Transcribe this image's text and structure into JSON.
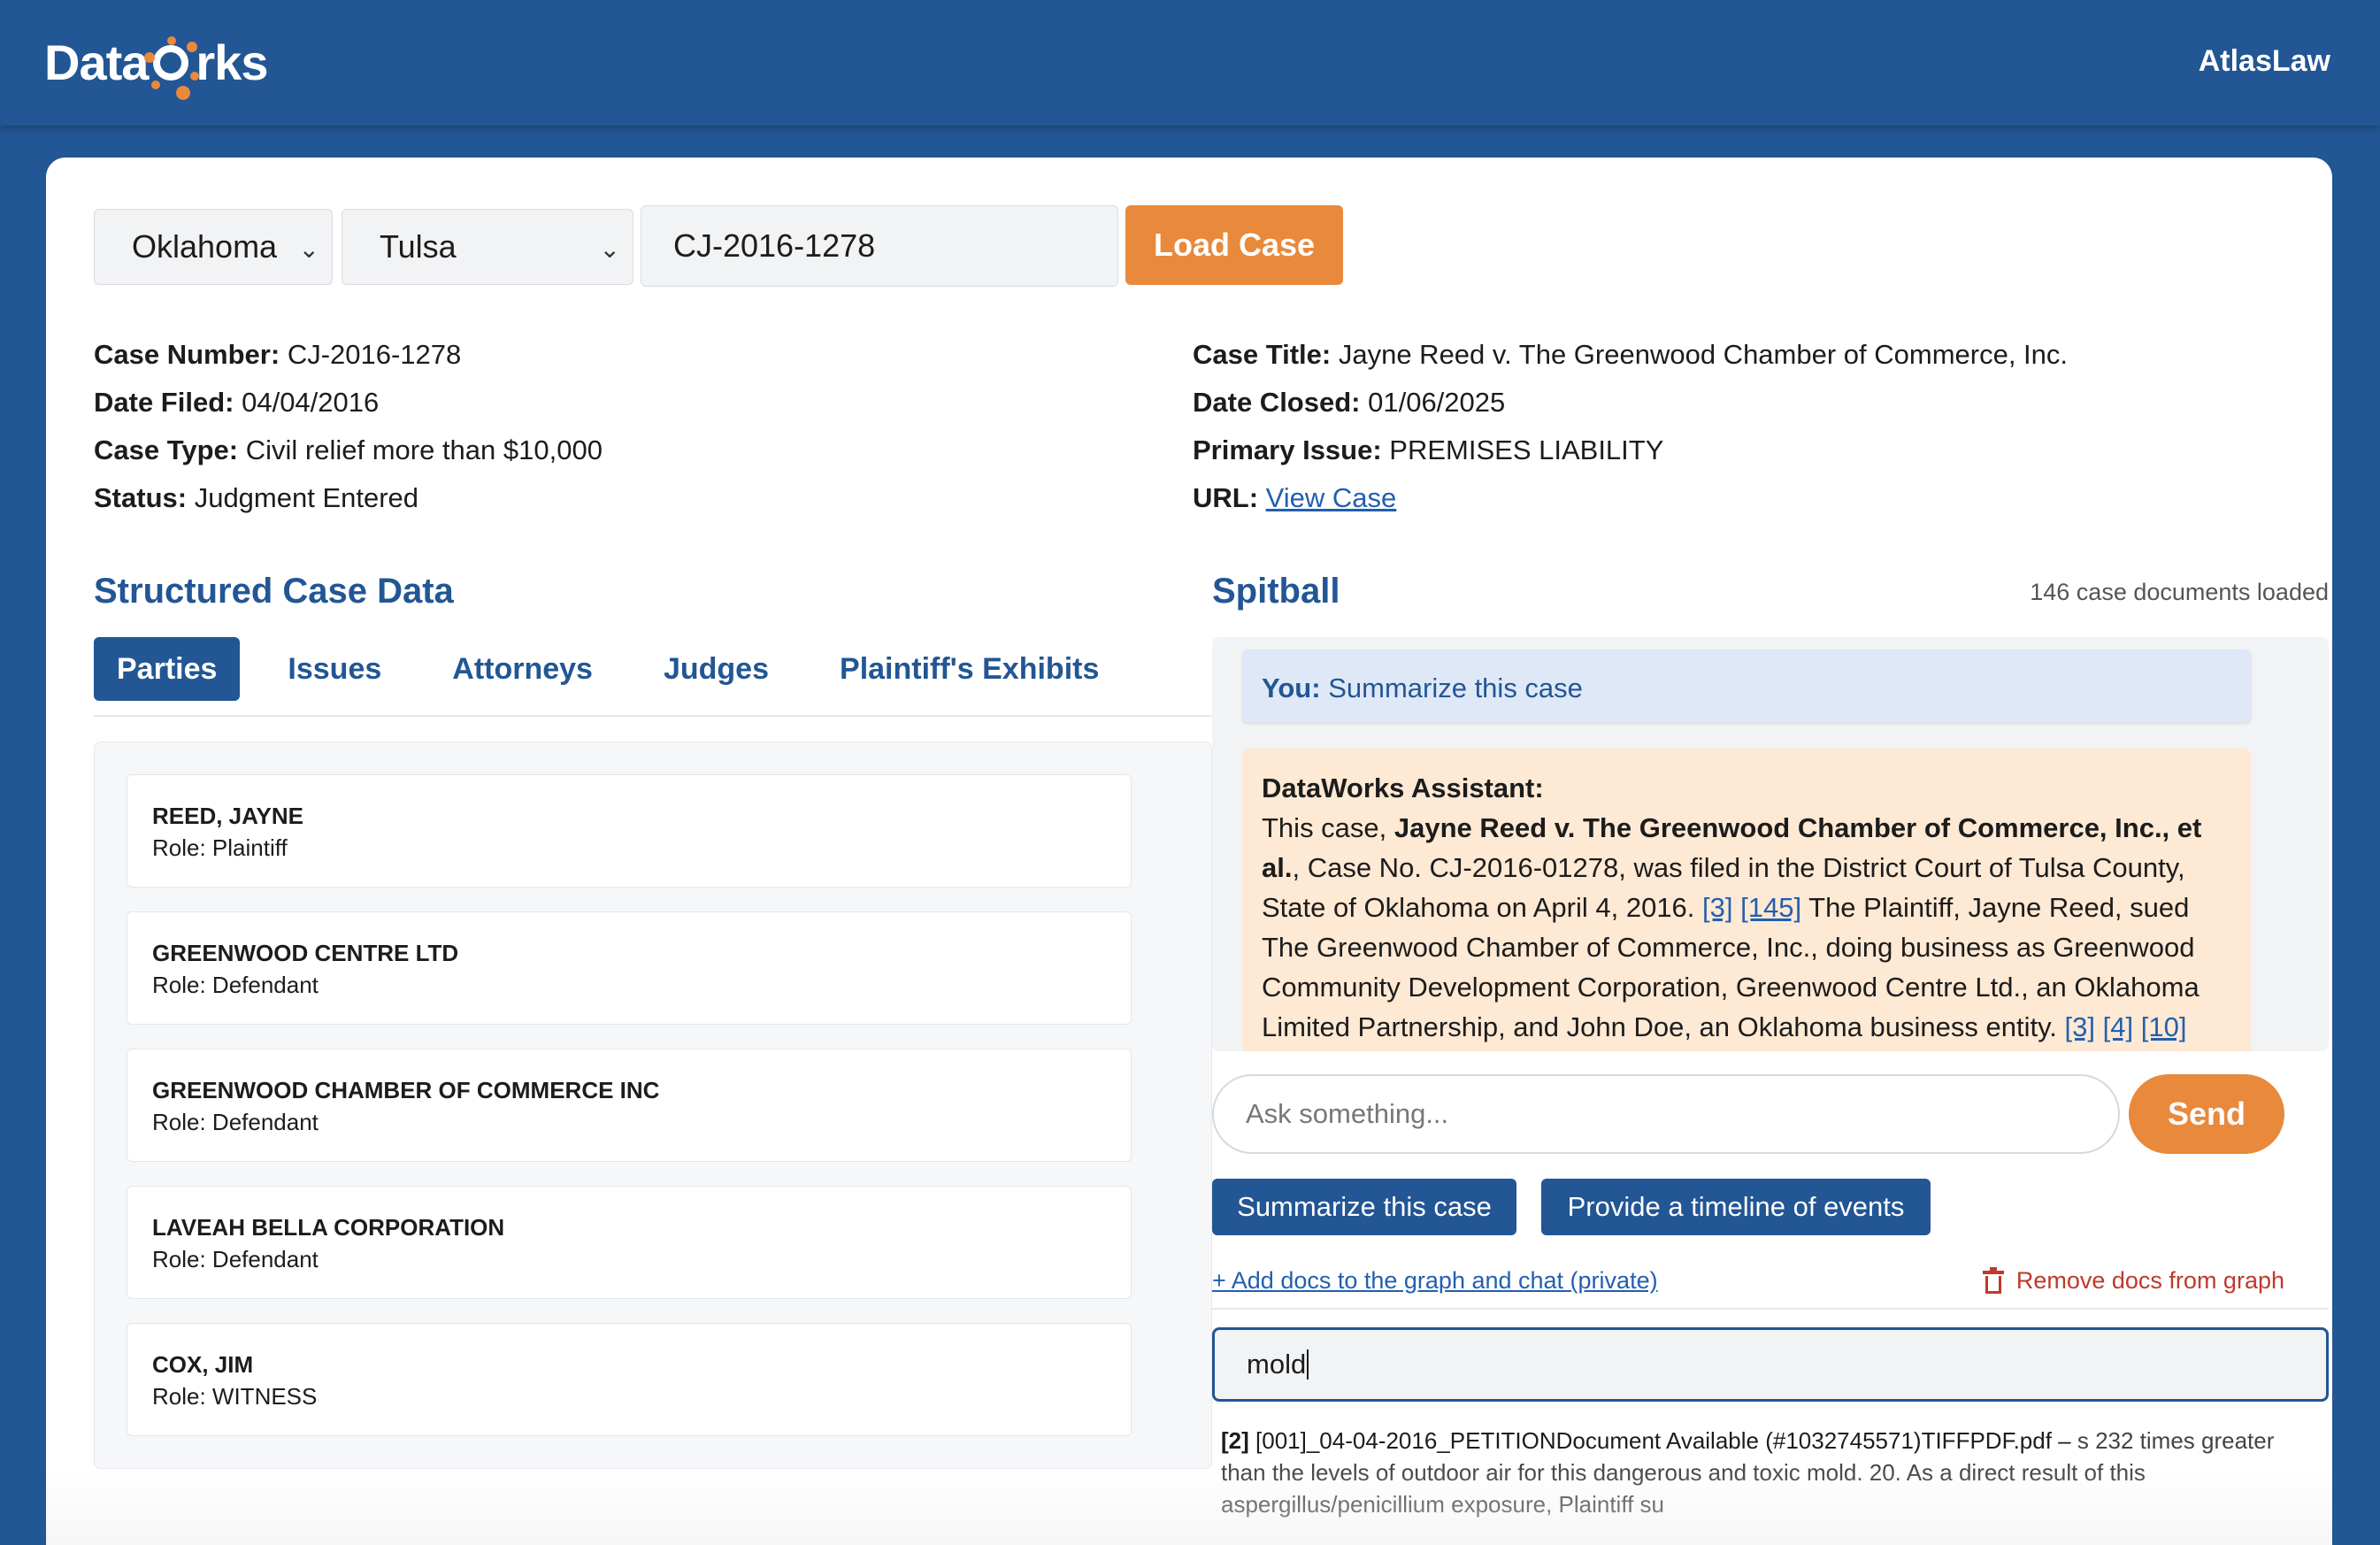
{
  "header": {
    "logo_text_a": "Data",
    "logo_text_b": "rks",
    "org": "AtlasLaw"
  },
  "controls": {
    "state": "Oklahoma",
    "county": "Tulsa",
    "case_number_value": "CJ-2016-1278",
    "load_label": "Load Case"
  },
  "case": {
    "left": [
      {
        "label": "Case Number:",
        "value": "CJ-2016-1278"
      },
      {
        "label": "Date Filed:",
        "value": "04/04/2016"
      },
      {
        "label": "Case Type:",
        "value": "Civil relief more than $10,000"
      },
      {
        "label": "Status:",
        "value": "Judgment Entered"
      }
    ],
    "right": [
      {
        "label": "Case Title:",
        "value": "Jayne Reed v. The Greenwood Chamber of Commerce, Inc."
      },
      {
        "label": "Date Closed:",
        "value": "01/06/2025"
      },
      {
        "label": "Primary Issue:",
        "value": "PREMISES LIABILITY"
      },
      {
        "label": "URL:",
        "value": "View Case"
      }
    ]
  },
  "structured": {
    "title": "Structured Case Data",
    "tabs": [
      "Parties",
      "Issues",
      "Attorneys",
      "Judges",
      "Plaintiff's Exhibits"
    ],
    "parties": [
      {
        "name": "REED,  JAYNE",
        "role": "Role: Plaintiff"
      },
      {
        "name": "GREENWOOD CENTRE LTD",
        "role": "Role: Defendant"
      },
      {
        "name": "GREENWOOD CHAMBER OF COMMERCE INC",
        "role": "Role: Defendant"
      },
      {
        "name": "LAVEAH BELLA CORPORATION",
        "role": "Role: Defendant"
      },
      {
        "name": "COX,  JIM",
        "role": "Role: WITNESS"
      }
    ]
  },
  "spitball": {
    "title": "Spitball",
    "doc_count": "146 case documents loaded",
    "you_label": "You:",
    "you_text": "Summarize this case",
    "assistant_label": "DataWorks Assistant:",
    "assistant_p1": "This case, ",
    "assistant_bold": "Jayne Reed v. The Greenwood Chamber of Commerce, Inc., et al.",
    "assistant_p2": ", Case No. CJ-2016-01278, was filed in the District Court of Tulsa County, State of Oklahoma on April 4, 2016. ",
    "cite_3": "[3]",
    "cite_145": "[145]",
    "assistant_p3": " The Plaintiff, Jayne Reed, sued The Greenwood Chamber of Commerce, Inc., doing business as Greenwood Community Development Corporation, Greenwood Centre Ltd., an Oklahoma Limited Partnership, and John Doe, an Oklahoma business entity. ",
    "cite_3b": "[3]",
    "cite_4": "[4]",
    "cite_10": "[10]",
    "ask_placeholder": "Ask something...",
    "send_label": "Send",
    "quick_1": "Summarize this case",
    "quick_2": "Provide a timeline of events",
    "add_docs": "+ Add docs to the graph and chat (private)",
    "remove_docs": "Remove docs from graph",
    "search_value": "mold",
    "result_num": "[2]",
    "result_file": "[001]_04-04-2016_PETITIONDocument Available (#1032745571)TIFFPDF.pdf –",
    "result_snippet": " s 232 times greater than the levels of outdoor air for this dangerous and toxic mold. 20. As a direct result of this aspergillus/penicillium exposure, Plaintiff su"
  },
  "colors": {
    "primary": "#225694",
    "accent": "#e8893b",
    "danger": "#c0392b",
    "link": "#225fb0"
  },
  "icons": [
    "chevron-down-icon",
    "trash-icon",
    "logo-nodes-icon"
  ]
}
